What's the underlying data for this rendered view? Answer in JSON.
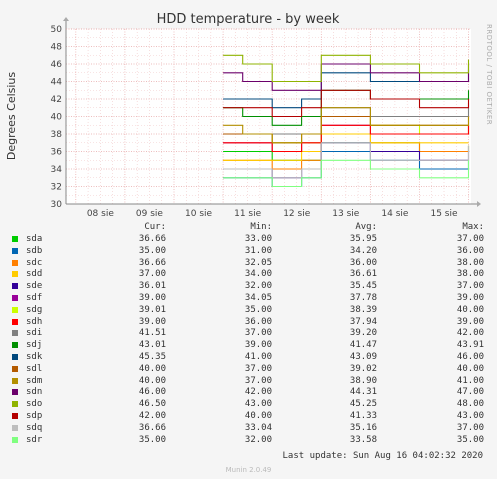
{
  "chart_data": {
    "type": "line",
    "title": "HDD temperature - by week",
    "ylabel": "Degrees Celsius",
    "ylim": [
      30,
      50
    ],
    "y_ticks": [
      30,
      32,
      34,
      36,
      38,
      40,
      42,
      44,
      46,
      48,
      50
    ],
    "x_ticks": [
      "08 sie",
      "09 sie",
      "10 sie",
      "11 sie",
      "12 sie",
      "13 sie",
      "14 sie",
      "15 sie"
    ],
    "xlim": [
      -0.2,
      8.05
    ],
    "grid": true,
    "side_label": "RRDTOOL / TOBI OETIKER",
    "columns": [
      "Cur:",
      "Min:",
      "Avg:",
      "Max:"
    ],
    "series": [
      {
        "name": "sda",
        "color": "#00cc00",
        "cur": "36.66",
        "min": "33.00",
        "avg": "35.95",
        "max": "37.00",
        "x": [
          3.0,
          3.4,
          4.0,
          4.6,
          5.0,
          6.0,
          7.0,
          8.0
        ],
        "y": [
          36,
          36,
          35,
          35,
          37,
          37,
          36,
          36.66
        ]
      },
      {
        "name": "sdb",
        "color": "#0066b3",
        "cur": "35.00",
        "min": "31.00",
        "avg": "34.20",
        "max": "36.00",
        "x": [
          3.0,
          3.4,
          4.0,
          4.6,
          5.0,
          6.0,
          7.0,
          8.0
        ],
        "y": [
          33,
          33,
          32,
          33,
          36,
          35,
          34,
          35
        ]
      },
      {
        "name": "sdc",
        "color": "#ff8000",
        "cur": "36.66",
        "min": "32.05",
        "avg": "36.00",
        "max": "38.00",
        "x": [
          3.0,
          3.4,
          4.0,
          4.6,
          5.0,
          6.0,
          7.0,
          8.0
        ],
        "y": [
          35,
          35,
          34,
          35,
          38,
          37,
          36,
          36.66
        ]
      },
      {
        "name": "sdd",
        "color": "#ffcc00",
        "cur": "37.00",
        "min": "34.00",
        "avg": "36.61",
        "max": "38.00",
        "x": [
          3.0,
          3.4,
          4.0,
          4.6,
          5.0,
          6.0,
          7.0,
          8.0
        ],
        "y": [
          35,
          35,
          35,
          36,
          38,
          37,
          37,
          37
        ]
      },
      {
        "name": "sde",
        "color": "#330099",
        "cur": "36.01",
        "min": "32.00",
        "avg": "35.45",
        "max": "37.00",
        "x": [
          3.0,
          3.4,
          4.0,
          4.6,
          5.0,
          6.0,
          7.0,
          8.0
        ],
        "y": [
          34,
          34,
          33,
          34,
          37,
          36,
          35,
          36.01
        ]
      },
      {
        "name": "sdf",
        "color": "#990099",
        "cur": "39.00",
        "min": "34.05",
        "avg": "37.78",
        "max": "39.00",
        "x": [
          3.0,
          3.4,
          4.0,
          4.6,
          5.0,
          6.0,
          7.0,
          8.0
        ],
        "y": [
          37,
          37,
          36,
          37,
          39,
          38,
          38,
          39
        ]
      },
      {
        "name": "sdg",
        "color": "#ccff00",
        "cur": "39.01",
        "min": "35.00",
        "avg": "38.39",
        "max": "40.00",
        "x": [
          3.0,
          3.4,
          4.0,
          4.6,
          5.0,
          6.0,
          7.0,
          8.0
        ],
        "y": [
          38,
          38,
          37,
          37,
          40,
          39,
          38,
          39.01
        ]
      },
      {
        "name": "sdh",
        "color": "#ff0000",
        "cur": "39.00",
        "min": "36.00",
        "avg": "37.94",
        "max": "39.00",
        "x": [
          3.0,
          3.4,
          4.0,
          4.6,
          5.0,
          6.0,
          7.0,
          8.0
        ],
        "y": [
          37,
          37,
          36,
          37,
          39,
          38,
          38,
          39
        ]
      },
      {
        "name": "sdi",
        "color": "#808080",
        "cur": "41.51",
        "min": "37.00",
        "avg": "39.20",
        "max": "42.00",
        "x": [
          3.0,
          3.4,
          4.0,
          4.6,
          5.0,
          6.0,
          7.0,
          8.0
        ],
        "y": [
          38,
          38,
          38,
          38,
          41,
          40,
          40,
          41.51
        ]
      },
      {
        "name": "sdj",
        "color": "#008f00",
        "cur": "43.01",
        "min": "39.00",
        "avg": "41.47",
        "max": "43.91",
        "x": [
          3.0,
          3.4,
          4.0,
          4.6,
          5.0,
          6.0,
          7.0,
          8.0
        ],
        "y": [
          41,
          40,
          39,
          40,
          43,
          42,
          42,
          43.01
        ]
      },
      {
        "name": "sdk",
        "color": "#00487d",
        "cur": "45.35",
        "min": "41.00",
        "avg": "43.09",
        "max": "46.00",
        "x": [
          3.0,
          3.4,
          4.0,
          4.6,
          5.0,
          6.0,
          7.0,
          8.0
        ],
        "y": [
          42,
          42,
          41,
          42,
          45,
          44,
          44,
          45.35
        ]
      },
      {
        "name": "sdl",
        "color": "#b35a00",
        "cur": "40.00",
        "min": "37.00",
        "avg": "39.02",
        "max": "40.00",
        "x": [
          3.0,
          3.4,
          4.0,
          4.6,
          5.0,
          6.0,
          7.0,
          8.0
        ],
        "y": [
          38,
          38,
          37,
          38,
          40,
          39,
          39,
          40
        ]
      },
      {
        "name": "sdm",
        "color": "#b38f00",
        "cur": "40.00",
        "min": "37.00",
        "avg": "38.90",
        "max": "41.00",
        "x": [
          3.0,
          3.4,
          4.0,
          4.6,
          5.0,
          6.0,
          7.0,
          8.0
        ],
        "y": [
          39,
          38,
          37,
          38,
          41,
          39,
          39,
          40
        ]
      },
      {
        "name": "sdn",
        "color": "#6b006b",
        "cur": "46.00",
        "min": "42.00",
        "avg": "44.31",
        "max": "47.00",
        "x": [
          3.0,
          3.4,
          4.0,
          4.6,
          5.0,
          6.0,
          7.0,
          8.0
        ],
        "y": [
          45,
          44,
          43,
          43,
          46,
          45,
          44,
          46
        ]
      },
      {
        "name": "sdo",
        "color": "#8fb300",
        "cur": "46.50",
        "min": "43.00",
        "avg": "45.25",
        "max": "48.00",
        "x": [
          3.0,
          3.4,
          4.0,
          4.6,
          5.0,
          6.0,
          7.0,
          8.0
        ],
        "y": [
          47,
          46,
          44,
          44,
          47,
          46,
          45,
          46.5
        ]
      },
      {
        "name": "sdp",
        "color": "#b30000",
        "cur": "42.00",
        "min": "40.00",
        "avg": "41.33",
        "max": "43.00",
        "x": [
          3.0,
          3.4,
          4.0,
          4.6,
          5.0,
          6.0,
          7.0,
          8.0
        ],
        "y": [
          41,
          41,
          40,
          41,
          43,
          42,
          41,
          42
        ]
      },
      {
        "name": "sdq",
        "color": "#bebebe",
        "cur": "36.66",
        "min": "33.04",
        "avg": "35.16",
        "max": "37.00",
        "x": [
          3.0,
          3.4,
          4.0,
          4.6,
          5.0,
          6.0,
          7.0,
          8.0
        ],
        "y": [
          34,
          34,
          33,
          34,
          37,
          35,
          35,
          36.66
        ]
      },
      {
        "name": "sdr",
        "color": "#80ff80",
        "cur": "35.00",
        "min": "32.00",
        "avg": "33.58",
        "max": "35.00",
        "x": [
          3.0,
          3.4,
          4.0,
          4.6,
          5.0,
          6.0,
          7.0,
          8.0
        ],
        "y": [
          33,
          33,
          32,
          33,
          35,
          34,
          33,
          35
        ]
      }
    ]
  },
  "footer": {
    "last_update": "Last update: Sun Aug 16 04:02:32 2020",
    "munin": "Munin 2.0.49"
  }
}
